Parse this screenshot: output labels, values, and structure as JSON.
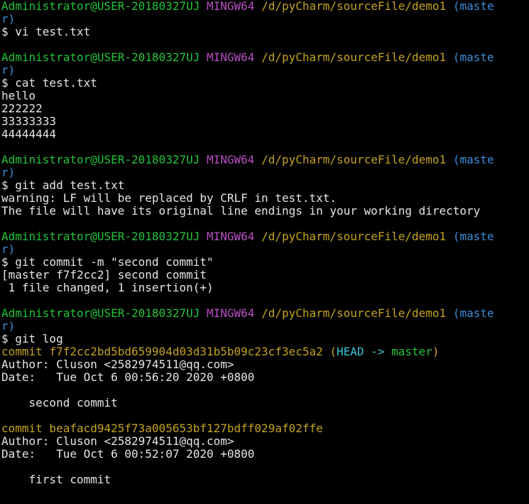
{
  "colors": {
    "default": "#e6e6e6",
    "user": "#23c43a",
    "shell": "#b84fc4",
    "path": "#c4a31f",
    "branch": "#3b8edb",
    "commit": "#c4a31f",
    "head": "#3ec2d4",
    "ref": "#23c43a"
  },
  "lines": [
    {
      "segments": [
        {
          "text": "Administrator@USER-20180327UJ",
          "color": "user"
        },
        {
          "text": " "
        },
        {
          "text": "MINGW64",
          "color": "shell"
        },
        {
          "text": " "
        },
        {
          "text": "/d/pyCharm/sourceFile/demo1",
          "color": "path"
        },
        {
          "text": " "
        },
        {
          "text": "(maste",
          "color": "branch"
        }
      ]
    },
    {
      "segments": [
        {
          "text": "r)",
          "color": "branch"
        }
      ]
    },
    {
      "segments": [
        {
          "text": "$ vi test.txt"
        }
      ]
    },
    {
      "segments": [
        {
          "text": ""
        }
      ]
    },
    {
      "segments": [
        {
          "text": "Administrator@USER-20180327UJ",
          "color": "user"
        },
        {
          "text": " "
        },
        {
          "text": "MINGW64",
          "color": "shell"
        },
        {
          "text": " "
        },
        {
          "text": "/d/pyCharm/sourceFile/demo1",
          "color": "path"
        },
        {
          "text": " "
        },
        {
          "text": "(maste",
          "color": "branch"
        }
      ]
    },
    {
      "segments": [
        {
          "text": "r)",
          "color": "branch"
        }
      ]
    },
    {
      "segments": [
        {
          "text": "$ cat test.txt"
        }
      ]
    },
    {
      "segments": [
        {
          "text": "hello"
        }
      ]
    },
    {
      "segments": [
        {
          "text": "222222"
        }
      ]
    },
    {
      "segments": [
        {
          "text": "33333333"
        }
      ]
    },
    {
      "segments": [
        {
          "text": "44444444"
        }
      ]
    },
    {
      "segments": [
        {
          "text": ""
        }
      ]
    },
    {
      "segments": [
        {
          "text": "Administrator@USER-20180327UJ",
          "color": "user"
        },
        {
          "text": " "
        },
        {
          "text": "MINGW64",
          "color": "shell"
        },
        {
          "text": " "
        },
        {
          "text": "/d/pyCharm/sourceFile/demo1",
          "color": "path"
        },
        {
          "text": " "
        },
        {
          "text": "(maste",
          "color": "branch"
        }
      ]
    },
    {
      "segments": [
        {
          "text": "r)",
          "color": "branch"
        }
      ]
    },
    {
      "segments": [
        {
          "text": "$ git add test.txt"
        }
      ]
    },
    {
      "segments": [
        {
          "text": "warning: LF will be replaced by CRLF in test.txt."
        }
      ]
    },
    {
      "segments": [
        {
          "text": "The file will have its original line endings in your working directory"
        }
      ]
    },
    {
      "segments": [
        {
          "text": ""
        }
      ]
    },
    {
      "segments": [
        {
          "text": "Administrator@USER-20180327UJ",
          "color": "user"
        },
        {
          "text": " "
        },
        {
          "text": "MINGW64",
          "color": "shell"
        },
        {
          "text": " "
        },
        {
          "text": "/d/pyCharm/sourceFile/demo1",
          "color": "path"
        },
        {
          "text": " "
        },
        {
          "text": "(maste",
          "color": "branch"
        }
      ]
    },
    {
      "segments": [
        {
          "text": "r)",
          "color": "branch"
        }
      ]
    },
    {
      "segments": [
        {
          "text": "$ git commit -m \"second commit\""
        }
      ]
    },
    {
      "segments": [
        {
          "text": "[master f7f2cc2] second commit"
        }
      ]
    },
    {
      "segments": [
        {
          "text": " 1 file changed, 1 insertion(+)"
        }
      ]
    },
    {
      "segments": [
        {
          "text": ""
        }
      ]
    },
    {
      "segments": [
        {
          "text": "Administrator@USER-20180327UJ",
          "color": "user"
        },
        {
          "text": " "
        },
        {
          "text": "MINGW64",
          "color": "shell"
        },
        {
          "text": " "
        },
        {
          "text": "/d/pyCharm/sourceFile/demo1",
          "color": "path"
        },
        {
          "text": " "
        },
        {
          "text": "(maste",
          "color": "branch"
        }
      ]
    },
    {
      "segments": [
        {
          "text": "r)",
          "color": "branch"
        }
      ]
    },
    {
      "segments": [
        {
          "text": "$ git log"
        }
      ]
    },
    {
      "segments": [
        {
          "text": "commit f7f2cc2bd5bd659904d03d31b5b09c23cf3ec5a2",
          "color": "commit"
        },
        {
          "text": " "
        },
        {
          "text": "(",
          "color": "commit"
        },
        {
          "text": "HEAD -> ",
          "color": "head"
        },
        {
          "text": "master",
          "color": "ref"
        },
        {
          "text": ")",
          "color": "commit"
        }
      ]
    },
    {
      "segments": [
        {
          "text": "Author: Cluson <2582974511@qq.com>"
        }
      ]
    },
    {
      "segments": [
        {
          "text": "Date:   Tue Oct 6 00:56:20 2020 +0800"
        }
      ]
    },
    {
      "segments": [
        {
          "text": ""
        }
      ]
    },
    {
      "segments": [
        {
          "text": "    second commit"
        }
      ]
    },
    {
      "segments": [
        {
          "text": ""
        }
      ]
    },
    {
      "segments": [
        {
          "text": "commit beafacd9425f73a005653bf127bdff029af02ffe",
          "color": "commit"
        }
      ]
    },
    {
      "segments": [
        {
          "text": "Author: Cluson <2582974511@qq.com>"
        }
      ]
    },
    {
      "segments": [
        {
          "text": "Date:   Tue Oct 6 00:52:07 2020 +0800"
        }
      ]
    },
    {
      "segments": [
        {
          "text": ""
        }
      ]
    },
    {
      "segments": [
        {
          "text": "    first commit"
        }
      ]
    }
  ]
}
